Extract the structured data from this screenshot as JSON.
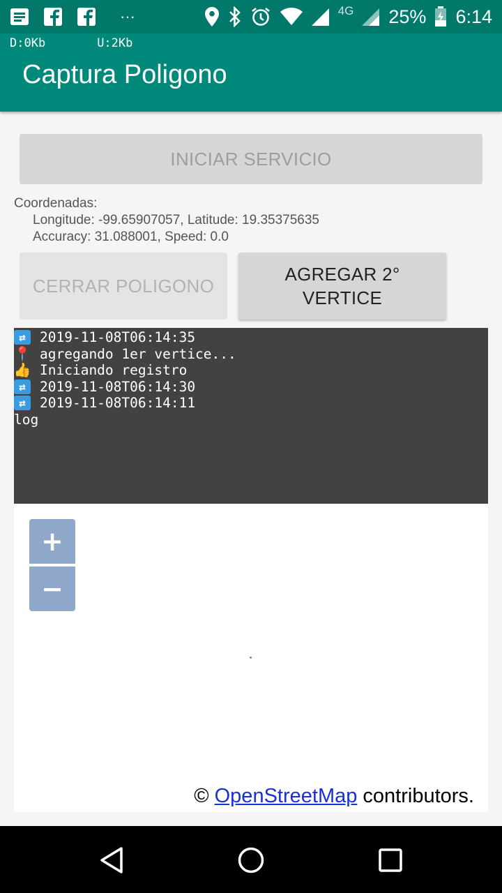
{
  "status_bar": {
    "battery": "25%",
    "time": "6:14",
    "network": "4G",
    "dots": "···",
    "icons": [
      "notes-icon",
      "facebook-icon",
      "facebook-icon",
      "location-icon",
      "bluetooth-icon",
      "alarm-icon",
      "wifi-icon",
      "signal-icon",
      "signal-icon",
      "battery-icon"
    ]
  },
  "app": {
    "download": "D:0Kb",
    "upload": "U:2Kb",
    "title": "Captura Poligono"
  },
  "buttons": {
    "start": "INICIAR SERVICIO",
    "close_polygon": "CERRAR POLIGONO",
    "add_vertex": "AGREGAR 2° VERTICE"
  },
  "coords": {
    "label": "Coordenadas:",
    "line1": "Longitude: -99.65907057, Latitude: 19.35375635",
    "line2": "Accuracy: 31.088001, Speed: 0.0"
  },
  "log": {
    "lines": [
      {
        "icon": "sync-icon",
        "glyph": "⇄",
        "text": "2019-11-08T06:14:35"
      },
      {
        "icon": "pin-icon",
        "glyph": "📍",
        "text": "agregando 1er vertice..."
      },
      {
        "icon": "thumbs-up-icon",
        "glyph": "👍",
        "text": "Iniciando registro"
      },
      {
        "icon": "sync-icon",
        "glyph": "⇄",
        "text": "2019-11-08T06:14:30"
      },
      {
        "icon": "sync-icon",
        "glyph": "⇄",
        "text": "2019-11-08T06:14:11"
      }
    ],
    "last": "log"
  },
  "map": {
    "zoom_in": "+",
    "zoom_out": "−",
    "attribution_prefix": "© ",
    "attribution_link": "OpenStreetMap",
    "attribution_suffix": " contributors."
  },
  "colors": {
    "status_bar": "#00796b",
    "app_bar": "#00897b",
    "log_bg": "#424242",
    "zoom_btn": "#8fa7c8",
    "link": "#1a2fd6"
  }
}
